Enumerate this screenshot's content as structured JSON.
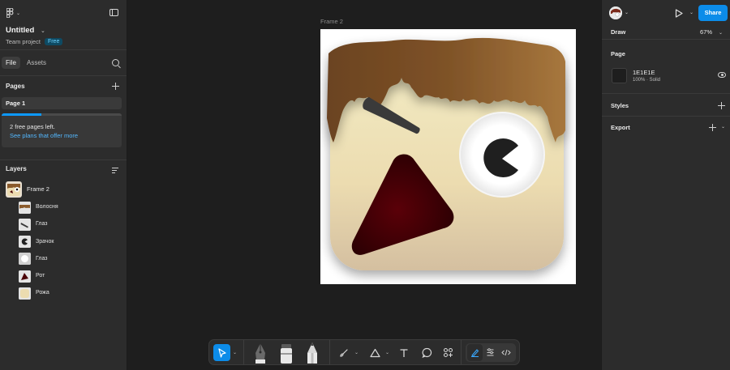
{
  "left_panel": {
    "file_title": "Untitled",
    "team_label": "Team project",
    "plan_badge": "Free",
    "tabs": {
      "file": "File",
      "assets": "Assets"
    },
    "pages_title": "Pages",
    "pages": [
      {
        "label": "Page 1"
      }
    ],
    "upsell": {
      "text": "2 free pages left.",
      "link": "See plans that offer more",
      "progress_fraction": 0.33
    },
    "layers_title": "Layers",
    "frame_layer": {
      "name": "Frame 2"
    },
    "layers": [
      {
        "name": "Волосня",
        "icon": "hair-thumbnail"
      },
      {
        "name": "Глаз",
        "icon": "brow-thumbnail"
      },
      {
        "name": "Зрачок",
        "icon": "pupil-thumbnail"
      },
      {
        "name": "Глаз",
        "icon": "eye-thumbnail"
      },
      {
        "name": "Рот",
        "icon": "mouth-thumbnail"
      },
      {
        "name": "Рожа",
        "icon": "face-thumbnail"
      }
    ]
  },
  "canvas": {
    "frame_label": "Frame 2",
    "colors": {
      "hair": "#8a5a2b",
      "face": "#ecdcb0",
      "mouth": "#4a0005",
      "pupil": "#1f1f1f",
      "frame_bg": "#ffffff"
    }
  },
  "toolbar": {
    "tools": [
      "move-tool",
      "pen-tool",
      "marker-tool",
      "pencil-tool",
      "brush-tool",
      "shape-tool",
      "text-tool",
      "comment-tool",
      "actions-tool",
      "draw-mode",
      "design-mode",
      "dev-mode"
    ],
    "accent": "#0c8ce9"
  },
  "right_panel": {
    "share_label": "Share",
    "draw_label": "Draw",
    "zoom": "67%",
    "page_section": {
      "title": "Page",
      "background_hex": "1E1E1E",
      "background_meta": "100% · Solid"
    },
    "styles_title": "Styles",
    "export_title": "Export"
  },
  "help_label": "?"
}
